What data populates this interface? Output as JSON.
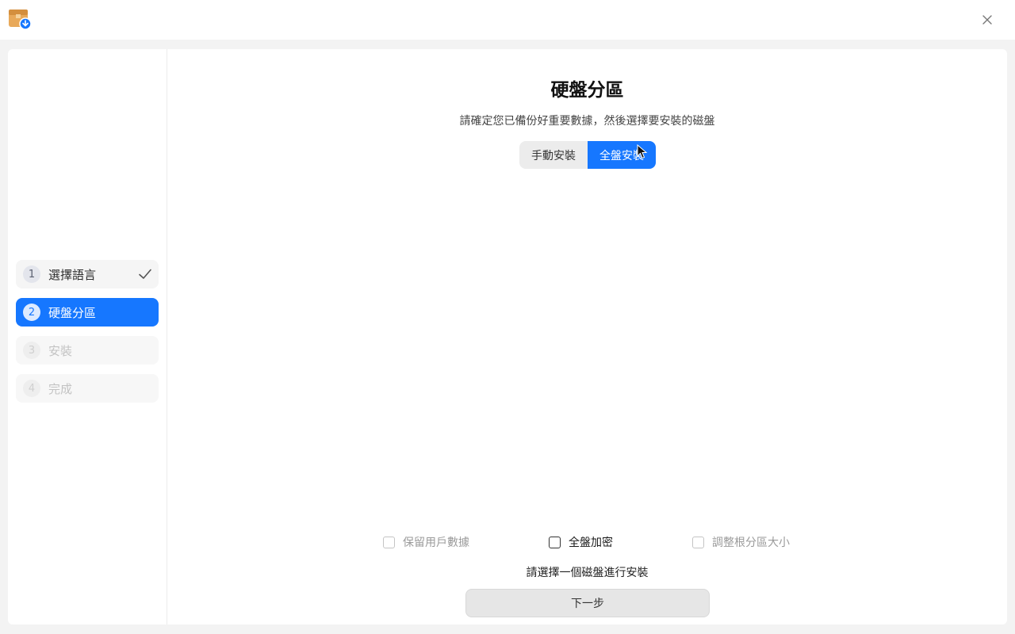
{
  "window": {
    "app_icon": "installer-box-icon",
    "close_icon": "close-icon"
  },
  "sidebar": {
    "steps": [
      {
        "number": "1",
        "label": "選擇語言",
        "state": "done"
      },
      {
        "number": "2",
        "label": "硬盤分區",
        "state": "active"
      },
      {
        "number": "3",
        "label": "安裝",
        "state": "disabled"
      },
      {
        "number": "4",
        "label": "完成",
        "state": "disabled"
      }
    ]
  },
  "main": {
    "title": "硬盤分區",
    "subtitle": "請確定您已備份好重要數據，然後選擇要安裝的磁盤",
    "mode_tabs": [
      {
        "label": "手動安裝",
        "selected": false
      },
      {
        "label": "全盤安裝",
        "selected": true
      }
    ],
    "options": [
      {
        "label": "保留用戶數據",
        "checked": false,
        "enabled": false
      },
      {
        "label": "全盤加密",
        "checked": false,
        "enabled": true
      },
      {
        "label": "調整根分區大小",
        "checked": false,
        "enabled": false
      }
    ],
    "hint": "請選擇一個磁盤進行安裝",
    "next_label": "下一步"
  },
  "colors": {
    "accent": "#1677ff",
    "background": "#f3f3f3",
    "panel": "#ffffff"
  }
}
